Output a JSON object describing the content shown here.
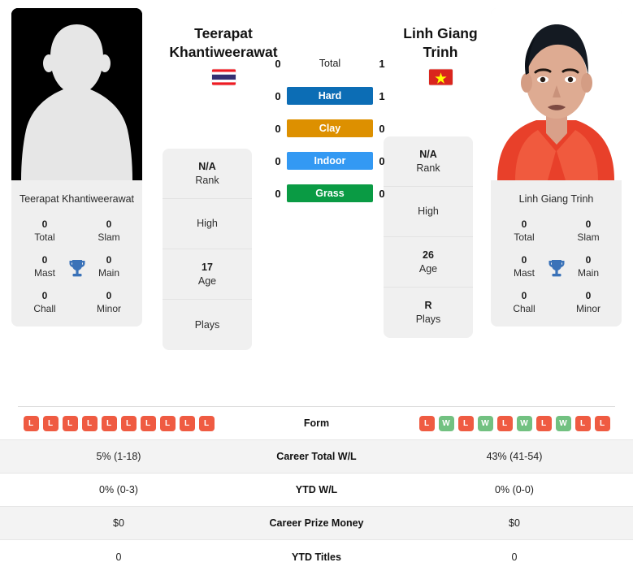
{
  "colors": {
    "hard": "#0c6db5",
    "clay": "#dd9000",
    "indoor": "#3399f3",
    "grass": "#0a9b44",
    "win": "#72c181",
    "loss": "#ef5b42",
    "trophy": "#3a72b8"
  },
  "players": {
    "left": {
      "name_line1": "Teerapat",
      "name_line2": "Khantiweerawat",
      "card_name": "Teerapat Khantiweerawat",
      "flag": "thailand-flag",
      "photo": "placeholder-avatar",
      "titles": [
        {
          "value": "0",
          "label": "Total"
        },
        {
          "value": "0",
          "label": "Slam"
        },
        {
          "value": "0",
          "label": "Mast"
        },
        {
          "value": "0",
          "label": "Main"
        },
        {
          "value": "0",
          "label": "Chall"
        },
        {
          "value": "0",
          "label": "Minor"
        }
      ],
      "stats": [
        {
          "value": "N/A",
          "label": "Rank"
        },
        {
          "value": "",
          "label": "High"
        },
        {
          "value": "17",
          "label": "Age"
        },
        {
          "value": "",
          "label": "Plays"
        }
      ],
      "form": [
        "L",
        "L",
        "L",
        "L",
        "L",
        "L",
        "L",
        "L",
        "L",
        "L"
      ]
    },
    "right": {
      "name_line1": "Linh Giang",
      "name_line2": "Trinh",
      "card_name": "Linh Giang Trinh",
      "flag": "vietnam-flag",
      "photo": "player-photo",
      "titles": [
        {
          "value": "0",
          "label": "Total"
        },
        {
          "value": "0",
          "label": "Slam"
        },
        {
          "value": "0",
          "label": "Mast"
        },
        {
          "value": "0",
          "label": "Main"
        },
        {
          "value": "0",
          "label": "Chall"
        },
        {
          "value": "0",
          "label": "Minor"
        }
      ],
      "stats": [
        {
          "value": "N/A",
          "label": "Rank"
        },
        {
          "value": "",
          "label": "High"
        },
        {
          "value": "26",
          "label": "Age"
        },
        {
          "value": "R",
          "label": "Plays"
        }
      ],
      "form": [
        "L",
        "W",
        "L",
        "W",
        "L",
        "W",
        "L",
        "W",
        "L",
        "L"
      ]
    }
  },
  "head_to_head": [
    {
      "label": "Total",
      "left": "0",
      "right": "1",
      "surface": false
    },
    {
      "label": "Hard",
      "left": "0",
      "right": "1",
      "surface": true
    },
    {
      "label": "Clay",
      "left": "0",
      "right": "0",
      "surface": true
    },
    {
      "label": "Indoor",
      "left": "0",
      "right": "0",
      "surface": true
    },
    {
      "label": "Grass",
      "left": "0",
      "right": "0",
      "surface": true
    }
  ],
  "compare_rows": [
    {
      "label": "Form",
      "left": "",
      "right": ""
    },
    {
      "label": "Career Total W/L",
      "left": "5% (1-18)",
      "right": "43% (41-54)"
    },
    {
      "label": "YTD W/L",
      "left": "0% (0-3)",
      "right": "0% (0-0)"
    },
    {
      "label": "Career Prize Money",
      "left": "$0",
      "right": "$0"
    },
    {
      "label": "YTD Titles",
      "left": "0",
      "right": "0"
    }
  ]
}
